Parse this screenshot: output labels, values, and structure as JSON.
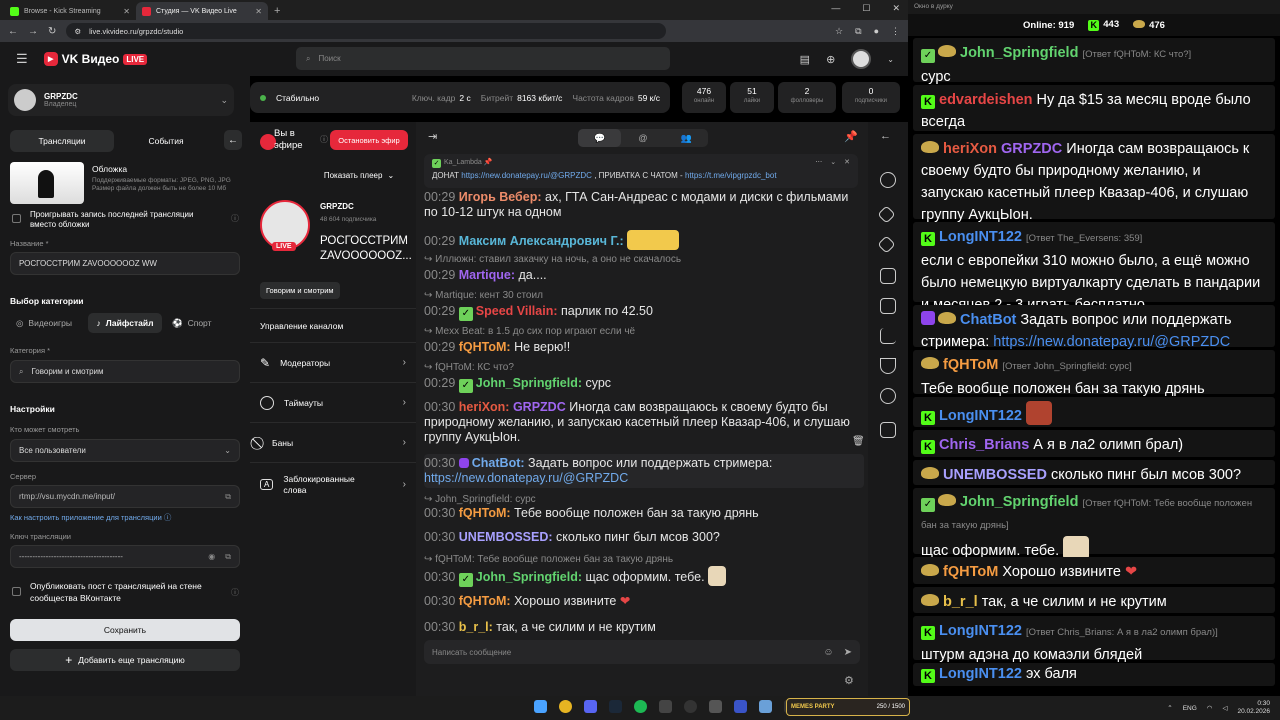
{
  "browser": {
    "tabs": [
      {
        "title": "Browse - Kick Streaming",
        "fav_color": "#53fc18"
      },
      {
        "title": "Студия — VK Видео Live",
        "fav_color": "#e6283b"
      }
    ],
    "url": "live.vkvideo.ru/grpzdc/studio"
  },
  "vk_header": {
    "logo": "VK Видео",
    "live_badge": "LIVE",
    "search_placeholder": "Поиск"
  },
  "channel": {
    "name": "GRPZDC",
    "role": "Владелец"
  },
  "status": {
    "state": "Стабильно",
    "keyframe_label": "Ключ. кадр",
    "keyframe_value": "2 с",
    "bitrate_label": "Битрейт",
    "bitrate_value": "8163 кбит/с",
    "fps_label": "Частота кадров",
    "fps_value": "59 к/с"
  },
  "stats": [
    {
      "value": "476",
      "label": "онлайн"
    },
    {
      "value": "51",
      "label": "лайки"
    },
    {
      "value": "2",
      "label": "фолловеры"
    },
    {
      "value": "0",
      "label": "подписчики"
    }
  ],
  "left": {
    "tab_streams": "Трансляции",
    "tab_events": "События",
    "cover_title": "Обложка",
    "cover_hint": "Поддерживаемые форматы: JPEG, PNG, JPG Размер файла должен быть не более 10 Мб",
    "replay_checkbox": "Проигрывать запись последней трансляции вместо обложки",
    "name_label": "Название *",
    "name_value": "РОСГОССТРИМ ZAVOOOOOOZ WW",
    "category_choice": "Выбор категории",
    "cat_games": "Видеоигры",
    "cat_life": "Лайфстайл",
    "cat_sport": "Спорт",
    "category_label": "Категория *",
    "category_value": "Говорим и смотрим",
    "settings": "Настройки",
    "who_watch_label": "Кто может смотреть",
    "who_watch_value": "Все пользователи",
    "server_label": "Сервер",
    "server_value": "rtmp://vsu.mycdn.me/input/",
    "setup_link": "Как настроить приложение для трансляции",
    "key_label": "Ключ трансляции",
    "key_value": "---------------------------------------",
    "publish_checkbox": "Опубликовать пост с трансляцией на стене сообщества ВКонтакте",
    "save": "Сохранить",
    "add_stream": "Добавить еще трансляцию"
  },
  "middle": {
    "on_air": "Вы в эфире",
    "stop": "Остановить эфир",
    "show_player": "Показать плеер",
    "preview_channel": "GRPZDC",
    "preview_subs": "48 604 подписчика",
    "preview_title": "РОСГОССТРИМ ZAVOOOOOOZ...",
    "preview_tag": "Говорим и смотрим",
    "manage": "Управление каналом",
    "menu": [
      "Модераторы",
      "Таймауты",
      "Баны",
      "Заблокированные слова"
    ]
  },
  "chat": {
    "pinned_author": "Ka_Lambda",
    "pinned_text_a": "ДОНАТ",
    "pinned_link_a": "https://new.donatepay.ru/@GRPZDC",
    "pinned_text_b": ", ПРИВАТКА С ЧАТОМ -",
    "pinned_link_b": "https://t.me/vipgrpzdc_bot",
    "input_placeholder": "Написать сообщение",
    "messages": [
      {
        "time": "00:29",
        "author": "Игорь Вебер:",
        "text": "ах, ГТА Сан-Андреас с модами и диски с фильмами по 10-12 штук на одном",
        "color": "#ed8c6a"
      },
      {
        "time": "00:29",
        "author": "Максим Александрович Г.:",
        "text": "",
        "color": "#59b7d8"
      },
      {
        "reply": "Иллюжн: ставил закачку на ночь, а оно не скачалось"
      },
      {
        "time": "00:29",
        "author": "Martique:",
        "text": "да....",
        "color": "#a066f0"
      },
      {
        "reply": "Martique: кент 30 стоил"
      },
      {
        "time": "00:29",
        "author": "Speed Villain:",
        "text": "парлик по 42.50",
        "color": "#e64646"
      },
      {
        "reply": "Мexx Beat: в 1.5 до сих пор играют если чё"
      },
      {
        "time": "00:29",
        "author": "fQHToM:",
        "text": "Не верю!!",
        "color": "#f59c42"
      },
      {
        "reply": "fQHToM: КС что?"
      },
      {
        "time": "00:29",
        "author": "John_Springfield:",
        "text": "сурс",
        "color": "#62d36f"
      },
      {
        "time": "00:30",
        "author": "heriXon:",
        "author2": "GRPZDC",
        "text": "Иногда сам возвращаюсь к своему будто бы природному желанию, и запускаю касетный плеер Квазар-406, и слушаю группу АукцЫон.",
        "color": "#e65a42"
      },
      {
        "time": "00:30",
        "author": "ChatBot:",
        "text": "Задать вопрос или поддержать стримера:",
        "link": "https://new.donatepay.ru/@GRPZDC",
        "color": "#71aaeb"
      },
      {
        "reply": "John_Springfield: сурс"
      },
      {
        "time": "00:30",
        "author": "fQHToM:",
        "text": "Тебе вообще положен бан за такую дрянь",
        "color": "#f59c42"
      },
      {
        "time": "00:30",
        "author": "UNEMBOSSED:",
        "text": "сколько пинг был мсов 300?",
        "color": "#a8a0ff"
      },
      {
        "reply": "fQHToM: Тебе вообще положен бан за такую дрянь"
      },
      {
        "time": "00:30",
        "author": "John_Springfield:",
        "text": "щас оформим. тебе.",
        "color": "#62d36f"
      },
      {
        "time": "00:30",
        "author": "fQHToM:",
        "text": "Хорошо извините",
        "color": "#f59c42"
      },
      {
        "time": "00:30",
        "author": "b_r_l:",
        "text": "так, а че силим и не крутим",
        "color": "#e8c04a"
      }
    ]
  },
  "overlay": {
    "window_title": "Окно в дурку",
    "online_label": "Online:",
    "online_value": "919",
    "kick_count": "443",
    "vk_count": "476",
    "messages": [
      {
        "author": "John_Springfield",
        "sub": "[Ответ fQHToM: КС что?]",
        "text": "сурс",
        "color": "#62d36f"
      },
      {
        "author": "edvardeishen",
        "text": "Ну да $15 за месяц вроде было всегда",
        "color": "#e64646"
      },
      {
        "author": "heriXon",
        "author2": "GRPZDC",
        "text": "Иногда сам возвращаюсь к своему будто бы природному желанию, и запускаю касетный плеер Квазар-406, и слушаю группу АукцЫон.",
        "color": "#e65a42"
      },
      {
        "author": "LongINT122",
        "sub": "[Ответ The_Eversens: 359]",
        "text": "если с европейки 310 можно было, а ещё можно было немецкую виртуалкарту сделать в пандарии и месяцев 2 - 3 играть бесплатно",
        "color": "#4a8ff0"
      },
      {
        "author": "ChatBot",
        "text": "Задать вопрос или поддержать стримера:",
        "link": "https://new.donatepay.ru/@GRPZDC",
        "color": "#4a8ff0"
      },
      {
        "author": "fQHToM",
        "sub": "[Ответ John_Springfield: сурс]",
        "text": "Тебе вообще положен бан за такую дрянь",
        "color": "#f59c42"
      },
      {
        "author": "LongINT122",
        "text": "",
        "color": "#4a8ff0"
      },
      {
        "author": "Chris_Brians",
        "text": "А я в ла2 олимп брал)",
        "color": "#a066f0"
      },
      {
        "author": "UNEMBOSSED",
        "text": "сколько пинг был мсов 300?",
        "color": "#a8a0ff"
      },
      {
        "author": "John_Springfield",
        "sub": "[Ответ fQHToM: Тебе вообще положен бан за такую дрянь]",
        "text": "щас оформим. тебе.",
        "color": "#62d36f"
      },
      {
        "author": "fQHToM",
        "text": "Хорошо извините",
        "color": "#f59c42"
      },
      {
        "author": "b_r_l",
        "text": "так, а че силим и не крутим",
        "color": "#e8c04a"
      },
      {
        "author": "LongINT122",
        "sub": "[Ответ Chris_Brians: А я в ла2 олимп брал)]",
        "text": "штурм адэна до комаэли блядей",
        "color": "#4a8ff0"
      },
      {
        "author": "LongINT122",
        "text": "эх баля",
        "color": "#4a8ff0"
      }
    ]
  },
  "taskbar": {
    "widget": "MEMES PARTY",
    "widget_counter": "250 / 1500",
    "lang": "ENG",
    "time": "0:30",
    "date": "20.02.2026"
  }
}
